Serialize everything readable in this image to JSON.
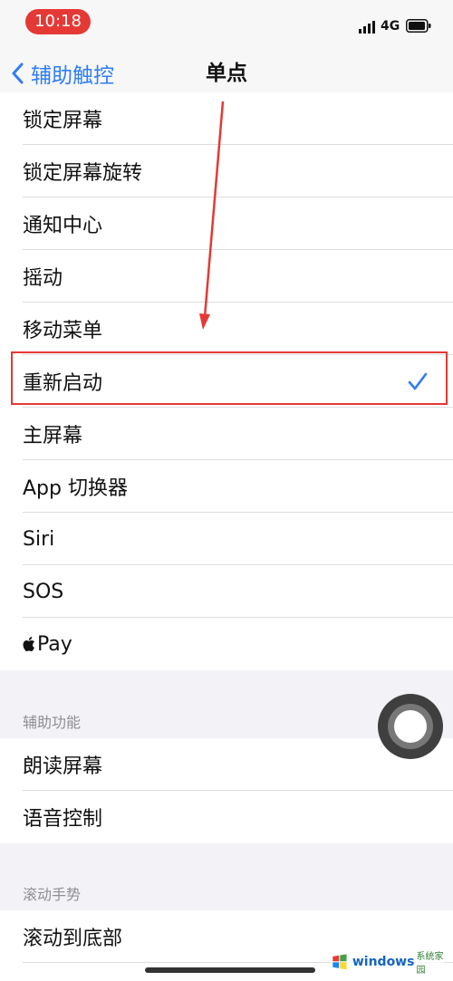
{
  "status_bar": {
    "time": "10:18",
    "network": "4G"
  },
  "nav": {
    "back_label": "辅助触控",
    "title": "单点"
  },
  "actions": [
    {
      "label": "锁定屏幕"
    },
    {
      "label": "锁定屏幕旋转"
    },
    {
      "label": "通知中心"
    },
    {
      "label": "摇动"
    },
    {
      "label": "移动菜单"
    },
    {
      "label": "重新启动",
      "selected": true
    },
    {
      "label": "主屏幕"
    },
    {
      "label": "App 切换器"
    },
    {
      "label": "Siri"
    },
    {
      "label": "SOS"
    },
    {
      "label": "Pay",
      "icon": "apple-logo-icon"
    }
  ],
  "accessibility": {
    "header": "辅助功能",
    "items": [
      {
        "label": "朗读屏幕"
      },
      {
        "label": "语音控制"
      }
    ]
  },
  "scroll_gestures": {
    "header": "滚动手势",
    "items": [
      {
        "label": "滚动到底部"
      }
    ]
  },
  "watermark": {
    "brand": "windows",
    "tag": "系统家园",
    "icon": "windows-logo-icon"
  },
  "colors": {
    "accent": "#2f7df6",
    "highlight": "#e53935"
  }
}
